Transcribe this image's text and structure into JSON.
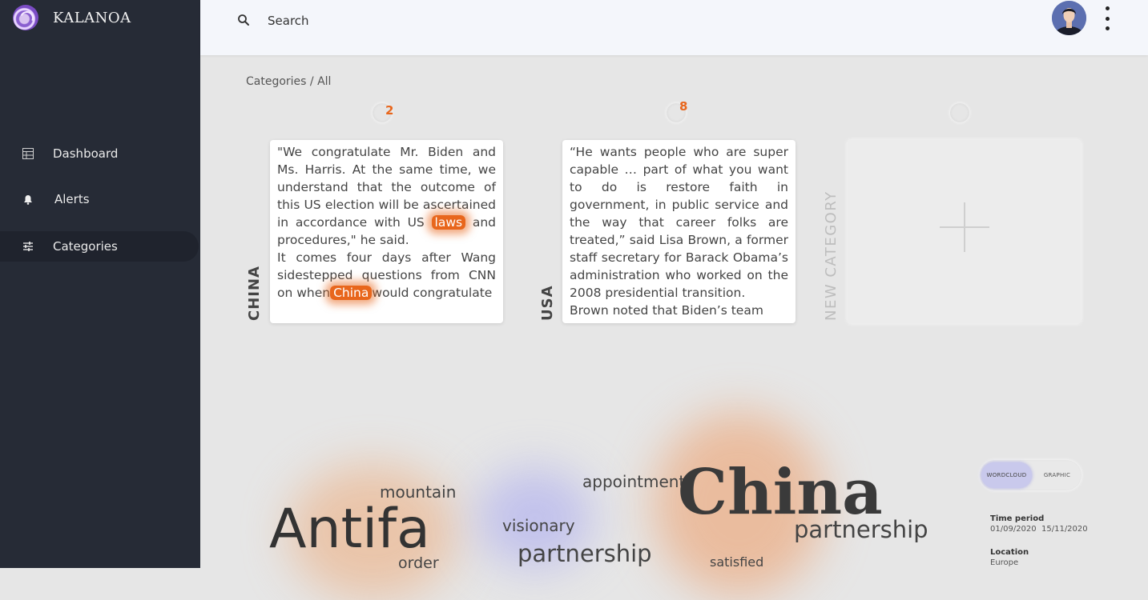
{
  "brand": {
    "name": "KALANOA"
  },
  "nav": [
    {
      "label": "Dashboard",
      "icon": "table-icon"
    },
    {
      "label": "Alerts",
      "icon": "bell-icon"
    },
    {
      "label": "Categories",
      "icon": "sliders-icon",
      "active": true
    }
  ],
  "search": {
    "placeholder": "Search"
  },
  "breadcrumb": "Categories / All",
  "categories": [
    {
      "name": "CHINA",
      "count": "2",
      "text1": "\"We congratulate Mr. Biden and Ms. Harris. At the same time, we understand that the outcome of this US election will be ascertained in accordance with US",
      "highlight1": "laws",
      "text2": "and procedures,\" he said.",
      "text3": "It comes four days after Wang sidestepped questions from CNN on when",
      "highlight2": "China",
      "text4": "would congratulate"
    },
    {
      "name": "USA",
      "count": "8",
      "text1": "“He wants people who are super capable … part of what you want to do is restore faith in government, in public service and the way that career folks are treated,” said Lisa Brown, a former staff secretary for Barack Obama’s administration who worked on the 2008 presidential transition.",
      "text2": "Brown noted that Biden’s team"
    }
  ],
  "new_category": {
    "label": "NEW CATEGORY"
  },
  "wordcloud": {
    "words": [
      "Antifa",
      "mountain",
      "order",
      "visionary",
      "partnership",
      "appointment",
      "China",
      "partnership",
      "satisfied"
    ]
  },
  "view_toggle": {
    "options": [
      "WORDCLOUD",
      "GRAPHIC"
    ],
    "selected": "WORDCLOUD"
  },
  "filters": {
    "time_period_label": "Time period",
    "time_period_value": "01/09/2020  15/11/2020",
    "location_label": "Location",
    "location_value": "Europe"
  },
  "colors": {
    "sidebar": "#262b36",
    "accent": "#e8661c",
    "toggle_active": "#c9c9ec"
  }
}
